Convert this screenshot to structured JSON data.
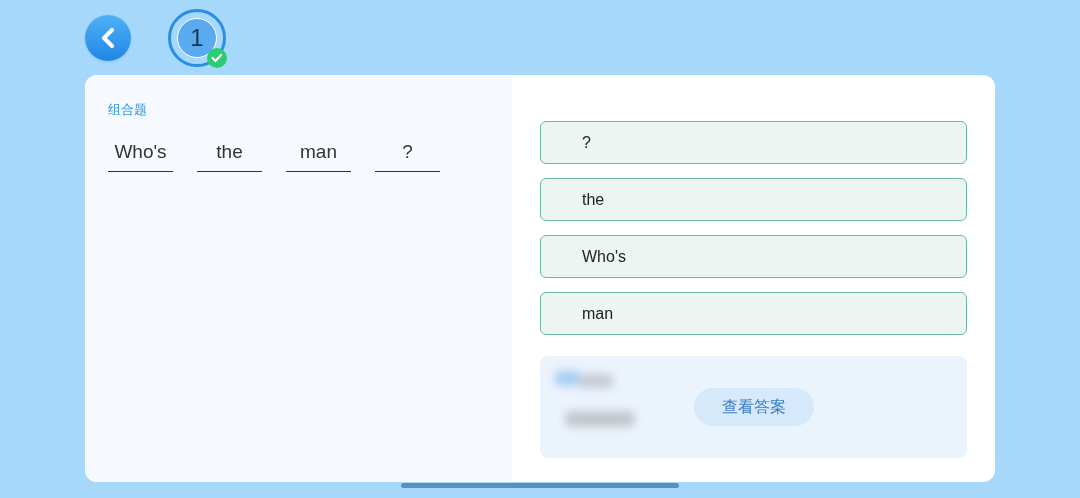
{
  "question_badge": {
    "number": "1",
    "completed": true
  },
  "question": {
    "type_label": "组合题",
    "slots": [
      {
        "word": "Who's"
      },
      {
        "word": "the"
      },
      {
        "word": "man"
      },
      {
        "word": "?"
      }
    ]
  },
  "options": [
    {
      "label": "?"
    },
    {
      "label": "the"
    },
    {
      "label": "Who's"
    },
    {
      "label": "man"
    }
  ],
  "answer_panel": {
    "button": "查看答案"
  }
}
